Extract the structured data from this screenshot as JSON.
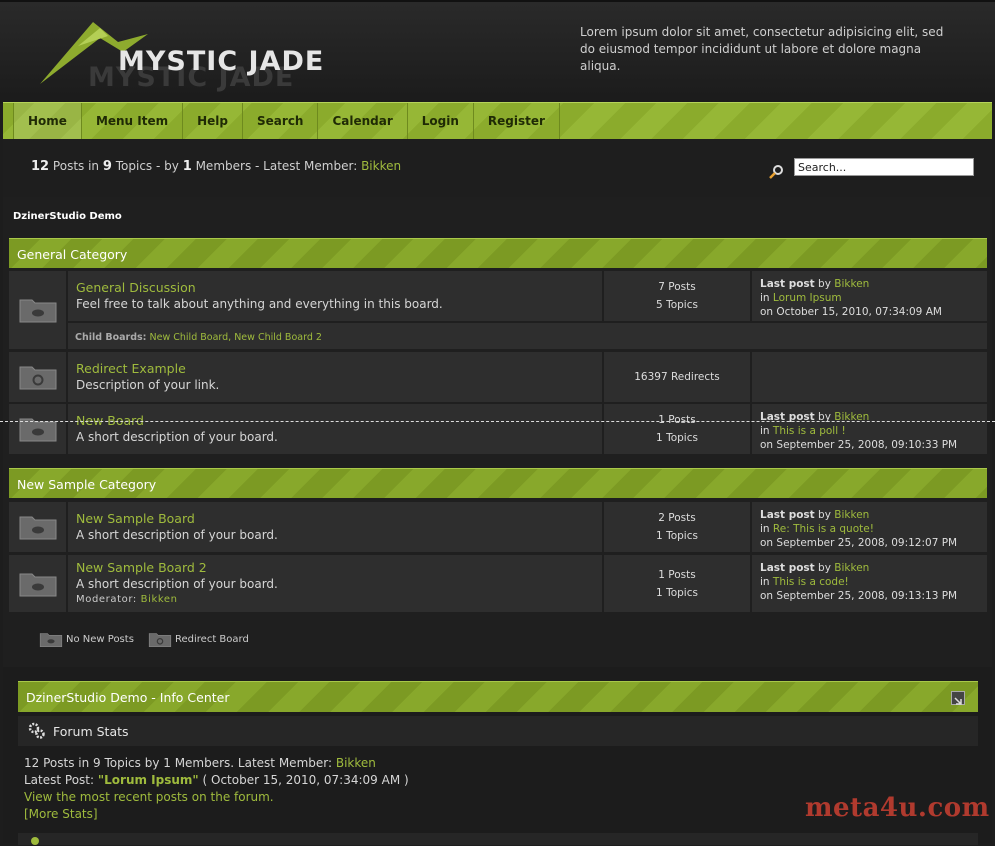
{
  "header": {
    "logo_text": "MYSTIC JADE",
    "tagline": "Lorem ipsum dolor sit amet, consectetur adipisicing elit, sed do eiusmod tempor incididunt ut labore et dolore magna aliqua."
  },
  "nav": {
    "items": [
      {
        "label": "Home"
      },
      {
        "label": "Menu Item"
      },
      {
        "label": "Help"
      },
      {
        "label": "Search"
      },
      {
        "label": "Calendar"
      },
      {
        "label": "Login"
      },
      {
        "label": "Register"
      }
    ]
  },
  "stats": {
    "posts": "12",
    "posts_in": "Posts in",
    "topics": "9",
    "topics_by": "Topics - by",
    "members": "1",
    "members_label": "Members - Latest Member:",
    "latest_member": "Bikken"
  },
  "search": {
    "placeholder": "Search...",
    "value": "Search..."
  },
  "forum_title": "DzinerStudio Demo",
  "categories": [
    {
      "name": "General Category",
      "boards": [
        {
          "name": "General Discussion",
          "desc": "Feel free to talk about anything and everything in this board.",
          "count1": "7 Posts",
          "count2": "5 Topics",
          "last_label": "Last post",
          "by": "by",
          "last_user": "Bikken",
          "in": "in",
          "last_topic": "Lorum Ipsum",
          "last_date": "on October 15, 2010, 07:34:09 AM",
          "child_label": "Child Boards:",
          "child_boards": "New Child Board, New Child Board 2"
        },
        {
          "name": "Redirect Example",
          "desc": "Description of your link.",
          "count1": "16397 Redirects"
        },
        {
          "name": "New Board",
          "desc": "A short description of your board.",
          "count1": "1 Posts",
          "count2": "1 Topics",
          "last_label": "Last post",
          "by": "by",
          "last_user": "Bikken",
          "in": "in",
          "last_topic": "This is a poll !",
          "last_date": "on September 25, 2008, 09:10:33 PM"
        }
      ]
    },
    {
      "name": "New Sample Category",
      "boards": [
        {
          "name": "New Sample Board",
          "desc": "A short description of your board.",
          "count1": "2 Posts",
          "count2": "1 Topics",
          "last_label": "Last post",
          "by": "by",
          "last_user": "Bikken",
          "in": "in",
          "last_topic": "Re: This is a quote!",
          "last_date": "on September 25, 2008, 09:12:07 PM"
        },
        {
          "name": "New Sample Board 2",
          "desc": "A short description of your board.",
          "moderator_label": "Moderator:",
          "moderator": "Bikken",
          "count1": "1 Posts",
          "count2": "1 Topics",
          "last_label": "Last post",
          "by": "by",
          "last_user": "Bikken",
          "in": "in",
          "last_topic": "This is a code!",
          "last_date": "on September 25, 2008, 09:13:13 PM"
        }
      ]
    }
  ],
  "legend": {
    "no_new": "No New Posts",
    "redirect": "Redirect Board"
  },
  "info_center": {
    "title": "DzinerStudio Demo - Info Center",
    "forum_stats": "Forum Stats",
    "line1_prefix": "12 Posts in 9 Topics by 1 Members. Latest Member:",
    "line1_member": "Bikken",
    "line2_prefix": "Latest Post:",
    "line2_topic": "\"Lorum Ipsum\"",
    "line2_date": "( October 15, 2010, 07:34:09 AM )",
    "recent_link": "View the most recent posts on the forum.",
    "more_stats": "[More Stats]"
  },
  "watermark": "meta4u.com",
  "colors": {
    "accent": "#9fbb3d",
    "nav_green": "#8bab2c",
    "background": "#1d1d1d"
  }
}
